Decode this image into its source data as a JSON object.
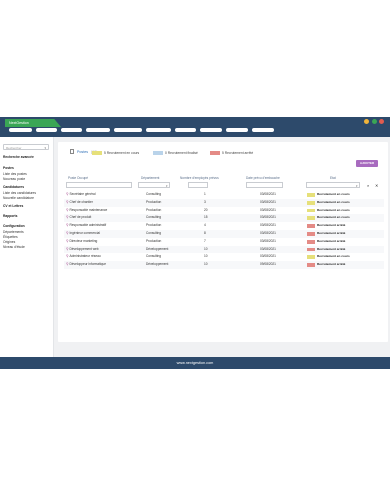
{
  "app": {
    "tab_label": "NextGestion"
  },
  "window_dots": [
    {
      "name": "minimize",
      "color": "#f1b43a"
    },
    {
      "name": "maximize",
      "color": "#3aa655"
    },
    {
      "name": "close",
      "color": "#e25c4f"
    }
  ],
  "sidebar": {
    "search_placeholder": "Rechercher",
    "advanced_search": "Recherche avancée",
    "items": [
      {
        "label": "Postes",
        "bold": true
      },
      {
        "label": "Liste des postes",
        "bold": false
      },
      {
        "label": "Nouveau poste",
        "bold": false
      },
      {
        "label": "Candidatures",
        "bold": true
      },
      {
        "label": "Liste des candidatures",
        "bold": false
      },
      {
        "label": "Nouvelle candidature",
        "bold": false
      },
      {
        "label": "CV et Lettres",
        "bold": true
      },
      {
        "label": "Rapports",
        "bold": true
      },
      {
        "label": "Configuration",
        "bold": true
      },
      {
        "label": "Départements",
        "bold": false
      },
      {
        "label": "Étiquettes",
        "bold": false
      },
      {
        "label": "Origines",
        "bold": false
      },
      {
        "label": "Niveau d'étude",
        "bold": false
      }
    ]
  },
  "breadcrumb": {
    "title": "Postes",
    "count": "(10)"
  },
  "legend": [
    {
      "label": "5 Recrutement en cours",
      "color": "#e6e07a"
    },
    {
      "label": "0 Recrutement finalisé",
      "color": "#b9d3ea"
    },
    {
      "label": "5 Recrutement arrêté",
      "color": "#e48b86"
    }
  ],
  "add_button": "AJOUTER",
  "table": {
    "headers": {
      "poste": "Poste Occupé",
      "departement": "Département",
      "employes": "Nombre d'employés prévus",
      "date": "Date prévu d'embauche",
      "etat": "Etat"
    },
    "rows": [
      {
        "poste": "Secrétaire général",
        "departement": "Consulting",
        "employes": "1",
        "date": "03/08/2021",
        "etat": "Recrutement en cours",
        "color": "#e6e07a"
      },
      {
        "poste": "Chef de chantier",
        "departement": "Production",
        "employes": "3",
        "date": "03/08/2021",
        "etat": "Recrutement en cours",
        "color": "#e6e07a"
      },
      {
        "poste": "Responsable maintenance",
        "departement": "Production",
        "employes": "20",
        "date": "03/08/2021",
        "etat": "Recrutement en cours",
        "color": "#e6e07a"
      },
      {
        "poste": "Chef de produit",
        "departement": "Consulting",
        "employes": "15",
        "date": "03/08/2021",
        "etat": "Recrutement en cours",
        "color": "#e6e07a"
      },
      {
        "poste": "Responsable administratif",
        "departement": "Production",
        "employes": "4",
        "date": "03/08/2021",
        "etat": "Recrutement arrêté",
        "color": "#e48b86"
      },
      {
        "poste": "Ingénieur commercial",
        "departement": "Consulting",
        "employes": "8",
        "date": "03/08/2021",
        "etat": "Recrutement arrêté",
        "color": "#e48b86"
      },
      {
        "poste": "Directeur marketing",
        "departement": "Production",
        "employes": "7",
        "date": "03/08/2021",
        "etat": "Recrutement arrêté",
        "color": "#e48b86"
      },
      {
        "poste": "Développement web",
        "departement": "Développement",
        "employes": "10",
        "date": "03/08/2021",
        "etat": "Recrutement arrêté",
        "color": "#e48b86"
      },
      {
        "poste": "Administrateur réseau",
        "departement": "Consulting",
        "employes": "10",
        "date": "03/08/2021",
        "etat": "Recrutement en cours",
        "color": "#e6e07a"
      },
      {
        "poste": "Développeur informatique",
        "departement": "Développement",
        "employes": "10",
        "date": "09/08/2021",
        "etat": "Recrutement arrêté",
        "color": "#e48b86"
      }
    ]
  },
  "footer": {
    "url": "www.nextgestion.com"
  }
}
